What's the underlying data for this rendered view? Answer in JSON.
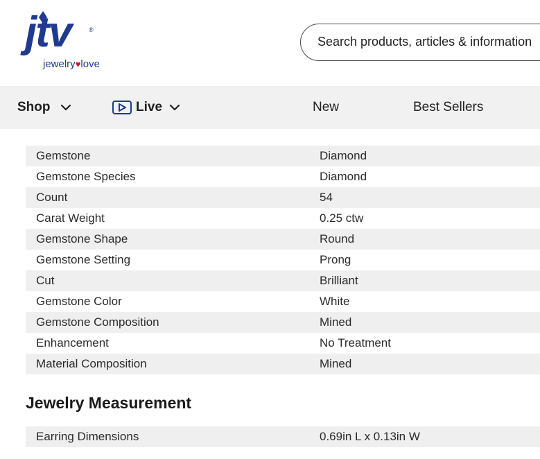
{
  "header": {
    "logo": {
      "main": "jtv",
      "tagline_left": "jewelry",
      "tagline_right": "love",
      "registered": "®",
      "brand_color": "#1f3a8f",
      "heart_color": "#c4142c"
    },
    "search": {
      "placeholder": "Search products, articles & information",
      "value": ""
    }
  },
  "nav": {
    "shop_label": "Shop",
    "live_label": "Live",
    "new_label": "New",
    "best_sellers_label": "Best Sellers",
    "background": "#f1f1f1"
  },
  "specs": [
    {
      "name": "Gemstone",
      "value": "Diamond"
    },
    {
      "name": "Gemstone Species",
      "value": "Diamond"
    },
    {
      "name": "Count",
      "value": "54"
    },
    {
      "name": "Carat Weight",
      "value": "0.25 ctw"
    },
    {
      "name": "Gemstone Shape",
      "value": "Round"
    },
    {
      "name": "Gemstone Setting",
      "value": "Prong"
    },
    {
      "name": "Cut",
      "value": "Brilliant"
    },
    {
      "name": "Gemstone Color",
      "value": "White"
    },
    {
      "name": "Gemstone Composition",
      "value": "Mined"
    },
    {
      "name": "Enhancement",
      "value": "No Treatment"
    },
    {
      "name": "Material Composition",
      "value": "Mined"
    }
  ],
  "measurement": {
    "title": "Jewelry Measurement",
    "rows": [
      {
        "name": "Earring Dimensions",
        "value": "0.69in L x 0.13in W"
      }
    ]
  }
}
